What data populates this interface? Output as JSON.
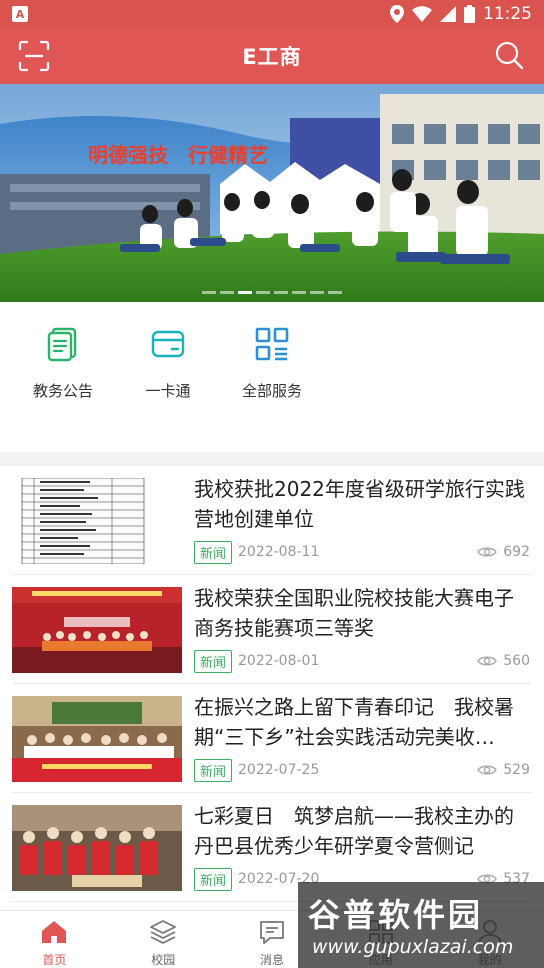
{
  "status": {
    "time": "11:25"
  },
  "header": {
    "title": "E工商"
  },
  "banner": {
    "slogan": "明德强技　行健精艺",
    "slide_count": 8,
    "active_slide": 2
  },
  "quick": [
    {
      "label": "教务公告",
      "icon": "document-icon"
    },
    {
      "label": "一卡通",
      "icon": "card-icon"
    },
    {
      "label": "全部服务",
      "icon": "grid-icon"
    }
  ],
  "news": [
    {
      "title": "我校获批2022年度省级研学旅行实践营地创建单位",
      "tag": "新闻",
      "date": "2022-08-11",
      "views": "692"
    },
    {
      "title": "我校荣获全国职业院校技能大赛电子商务技能赛项三等奖",
      "tag": "新闻",
      "date": "2022-08-01",
      "views": "560"
    },
    {
      "title": "在振兴之路上留下青春印记　我校暑期“三下乡”社会实践活动完美收…",
      "tag": "新闻",
      "date": "2022-07-25",
      "views": "529"
    },
    {
      "title": "七彩夏日　筑梦启航——我校主办的丹巴县优秀少年研学夏令营侧记",
      "tag": "新闻",
      "date": "2022-07-20",
      "views": "537"
    }
  ],
  "tabs": [
    {
      "label": "首页",
      "icon": "home-icon"
    },
    {
      "label": "校园",
      "icon": "layers-icon"
    },
    {
      "label": "消息",
      "icon": "message-icon"
    },
    {
      "label": "应用",
      "icon": "apps-icon"
    },
    {
      "label": "我的",
      "icon": "user-icon"
    }
  ],
  "watermark": {
    "title": "谷普软件园",
    "url": "www.gupuxlazai.com"
  },
  "colors": {
    "brand": "#e05654",
    "tag_green": "#3cae5f",
    "quick_green": "#2cb36a",
    "quick_teal": "#17b3b8",
    "quick_blue": "#2d8fd6"
  }
}
